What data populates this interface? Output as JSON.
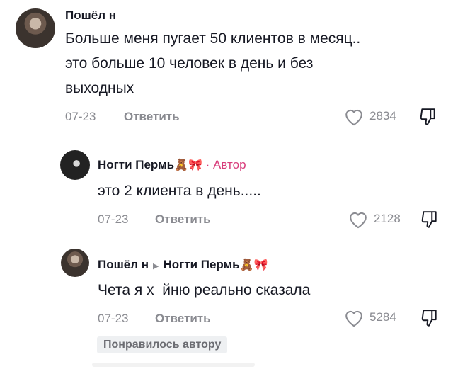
{
  "comments": [
    {
      "username": "Пошёл н",
      "text_line1": "Больше меня пугает 50 клиентов в месяц..",
      "text_line2": "это больше 10 человек в день и без",
      "text_line3": "выходных",
      "date": "07-23",
      "reply_label": "Ответить",
      "likes": "2834"
    },
    {
      "username": "Ногти Пермь",
      "emoji": "🧸🎀",
      "author_tag": " · Автор",
      "text": "это 2 клиента в день.....",
      "date": "07-23",
      "reply_label": "Ответить",
      "likes": "2128"
    },
    {
      "username": "Пошёл н",
      "reply_to": "Ногти Пермь",
      "emoji": "🧸🎀",
      "text": "Чета я х  йню реально сказала",
      "date": "07-23",
      "reply_label": "Ответить",
      "likes": "5284",
      "liked_by_author": "Понравилось автору"
    }
  ],
  "icons": {
    "heart": "heart-outline-icon",
    "dislike": "thumbs-down-icon",
    "reply_arrow": "play-arrow-icon"
  }
}
